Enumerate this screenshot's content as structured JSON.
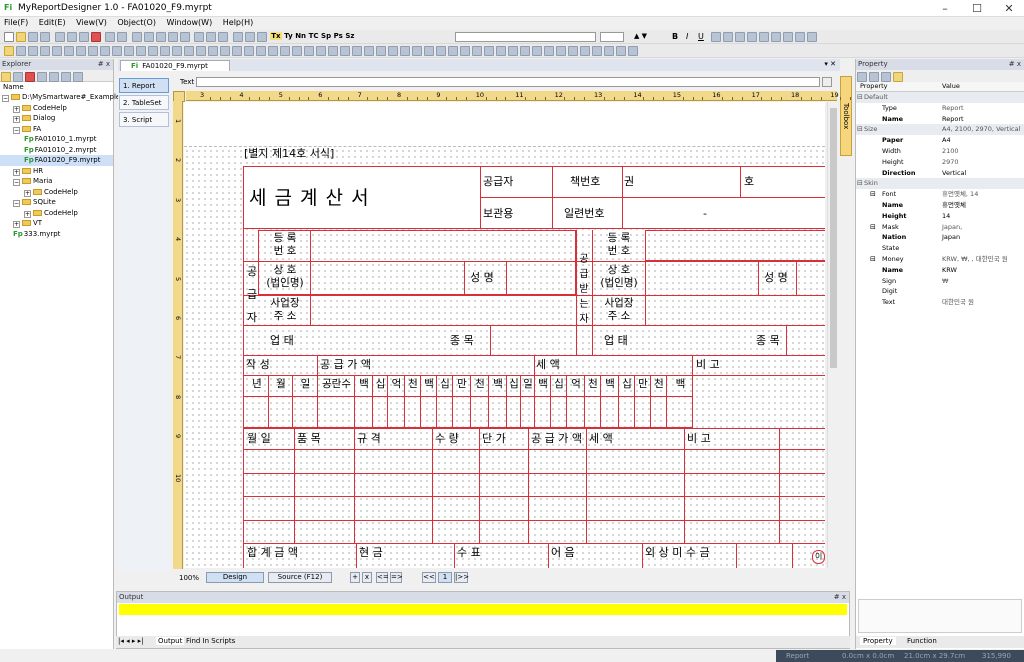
{
  "window": {
    "app_icon": "Fi",
    "title": "MyReportDesigner 1.0 - FA01020_F9.myrpt"
  },
  "menu": [
    "File(F)",
    "Edit(E)",
    "View(V)",
    "Object(O)",
    "Window(W)",
    "Help(H)"
  ],
  "toolbar": {
    "text_format_buttons": [
      "Tx",
      "Ty",
      "Nn",
      "TC",
      "Sp",
      "Ps",
      "Sz"
    ],
    "bold": "B",
    "italic": "I",
    "underline": "U"
  },
  "explorer": {
    "title": "Explorer",
    "pin": "# x",
    "column_header": "Name",
    "tree": [
      {
        "level": 0,
        "label": "D:\\MySmartware#_Example...",
        "type": "folder",
        "expanded": true
      },
      {
        "level": 1,
        "label": "CodeHelp",
        "type": "folder"
      },
      {
        "level": 1,
        "label": "Dialog",
        "type": "folder"
      },
      {
        "level": 1,
        "label": "FA",
        "type": "folder",
        "expanded": true
      },
      {
        "level": 2,
        "label": "FA01010_1.myrpt",
        "type": "file"
      },
      {
        "level": 2,
        "label": "FA01010_2.myrpt",
        "type": "file"
      },
      {
        "level": 2,
        "label": "FA01020_F9.myrpt",
        "type": "file",
        "selected": true
      },
      {
        "level": 1,
        "label": "HR",
        "type": "folder"
      },
      {
        "level": 1,
        "label": "Maria",
        "type": "folder",
        "expanded": true
      },
      {
        "level": 2,
        "label": "CodeHelp",
        "type": "folder"
      },
      {
        "level": 1,
        "label": "SQLite",
        "type": "folder",
        "expanded": true
      },
      {
        "level": 2,
        "label": "CodeHelp",
        "type": "folder"
      },
      {
        "level": 1,
        "label": "VT",
        "type": "folder"
      },
      {
        "level": 1,
        "label": "333.myrpt",
        "type": "file"
      }
    ]
  },
  "document": {
    "tab_icon": "Fi",
    "tab_label": "FA01020_F9.myrpt",
    "side_tabs": [
      "1. Report",
      "2. TableSet",
      "3. Script"
    ],
    "text_label": "Text",
    "toolbox_label": "Toolbox",
    "ruler_numbers": [
      "3",
      "4",
      "5",
      "6",
      "7",
      "8",
      "9",
      "10",
      "11",
      "12",
      "13",
      "14",
      "15",
      "16",
      "17",
      "18",
      "19"
    ],
    "vruler_numbers": [
      "1",
      "2",
      "3",
      "4",
      "5",
      "6",
      "7",
      "8",
      "9",
      "10"
    ],
    "zoom": "100%",
    "view_tabs": [
      "Design",
      "Source (F12)"
    ],
    "nav_buttons": [
      "+",
      "x",
      "<=",
      "=>",
      "<<",
      "1",
      "|>>"
    ]
  },
  "invoice": {
    "form_no": "[별지 제14호 서식]",
    "title": "세 금 계 산 서",
    "supplier_lbl": "공급자",
    "keeper_lbl": "보관용",
    "book_no_lbl": "책번호",
    "volume": "권",
    "number": "호",
    "serial_lbl": "일련번호",
    "dash": "-",
    "left_side": "공 급 자",
    "right_side": "공급받는자",
    "reg_no": "등 록\n번 호",
    "company": "상 호\n(법인명)",
    "ceo": "성 명",
    "address": "사업장\n주 소",
    "biz_type": "업 태",
    "biz_item": "종 목",
    "row_date": "작 성",
    "row_supply_amount": "공 급 가 액",
    "row_tax": "세 액",
    "row_note": "비 고",
    "date_cols": [
      "년",
      "월",
      "일"
    ],
    "blank_count": "공란수",
    "digits": [
      "백",
      "십",
      "억",
      "천",
      "백",
      "십",
      "만",
      "천",
      "백",
      "십",
      "일"
    ],
    "item_header": [
      "월 일",
      "품 목",
      "규 격",
      "수 량",
      "단 가",
      "공 급 가 액",
      "세 액",
      "비 고"
    ],
    "footer": [
      "합 계 금 액",
      "현 금",
      "수 표",
      "어 음",
      "외 상 미 수 금"
    ],
    "footer_tail": "이"
  },
  "output": {
    "title": "Output",
    "pin": "# x",
    "tabs": [
      "Output",
      "Find In Scripts"
    ]
  },
  "property": {
    "title": "Property",
    "pin": "# x",
    "col_property": "Property",
    "col_value": "Value",
    "rows": [
      {
        "kind": "cat",
        "name": "Default"
      },
      {
        "name": "Type",
        "value": "Report"
      },
      {
        "name": "Name",
        "value": "Report",
        "bold": true
      },
      {
        "kind": "cat",
        "name": "Size",
        "value": "A4, 2100, 2970, Vertical"
      },
      {
        "name": "Paper",
        "value": "A4",
        "bold": true
      },
      {
        "name": "Width",
        "value": "2100"
      },
      {
        "name": "Height",
        "value": "2970"
      },
      {
        "name": "Direction",
        "value": "Vertical",
        "bold": true
      },
      {
        "kind": "cat",
        "name": "Skin"
      },
      {
        "kind": "sub",
        "name": "Font",
        "value": "휴먼옛체, 14"
      },
      {
        "name": "Name",
        "value": "휴먼옛체",
        "bold": true
      },
      {
        "name": "Height",
        "value": "14",
        "bold": true
      },
      {
        "kind": "sub",
        "name": "Mask",
        "value": "Japan,"
      },
      {
        "name": "Nation",
        "value": "Japan",
        "bold": true
      },
      {
        "name": "State",
        "value": ""
      },
      {
        "kind": "sub",
        "name": "Money",
        "value": "KRW, ₩, , 대한민국 원"
      },
      {
        "name": "Name",
        "value": "KRW",
        "bold": true
      },
      {
        "name": "Sign",
        "value": "₩"
      },
      {
        "name": "Digit",
        "value": ""
      },
      {
        "name": "Text",
        "value": "대한민국 원"
      }
    ],
    "tabs": [
      "Property",
      "Function"
    ]
  },
  "status": {
    "mode": "Report",
    "pos": "0.0cm x 0.0cm",
    "size": "21.0cm x 29.7cm",
    "zoom": "315,990"
  }
}
